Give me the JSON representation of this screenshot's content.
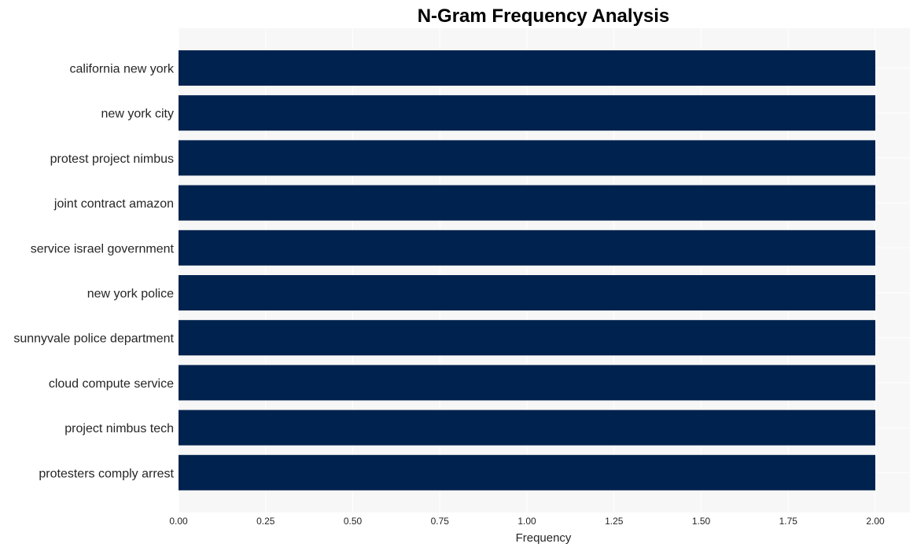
{
  "chart_data": {
    "type": "bar",
    "orientation": "horizontal",
    "title": "N-Gram Frequency Analysis",
    "xlabel": "Frequency",
    "ylabel": "",
    "categories": [
      "california new york",
      "new york city",
      "protest project nimbus",
      "joint contract amazon",
      "service israel government",
      "new york police",
      "sunnyvale police department",
      "cloud compute service",
      "project nimbus tech",
      "protesters comply arrest"
    ],
    "values": [
      2,
      2,
      2,
      2,
      2,
      2,
      2,
      2,
      2,
      2
    ],
    "xlim": [
      0,
      2.1
    ],
    "xticks": [
      "0.00",
      "0.25",
      "0.50",
      "0.75",
      "1.00",
      "1.25",
      "1.50",
      "1.75",
      "2.00"
    ],
    "xtick_values": [
      0,
      0.25,
      0.5,
      0.75,
      1.0,
      1.25,
      1.5,
      1.75,
      2.0
    ],
    "grid": true,
    "colors": {
      "bar": "#00224e",
      "plot_bg": "#f7f7f7",
      "grid": "#ffffff"
    }
  }
}
